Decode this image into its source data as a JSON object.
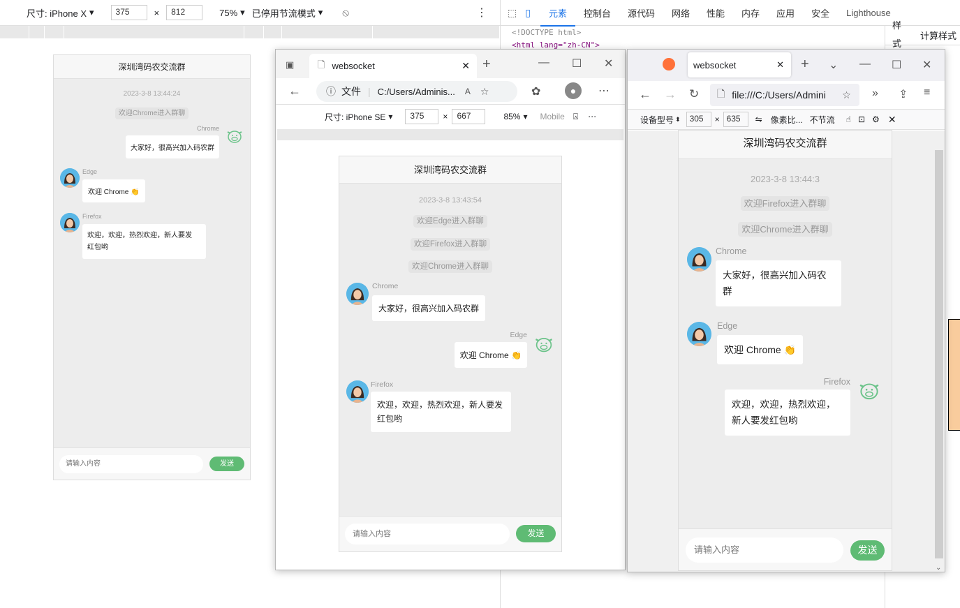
{
  "devtools_bar": {
    "device": "尺寸: iPhone X",
    "width": "375",
    "height": "812",
    "zoom": "75%",
    "throttle": "已停用节流模式"
  },
  "devtools_tabs": [
    "元素",
    "控制台",
    "源代码",
    "网络",
    "性能",
    "内存",
    "应用",
    "安全",
    "Lighthouse"
  ],
  "devtools_side_tabs": [
    "样式",
    "计算样式"
  ],
  "devtools_code": [
    "<!DOCTYPE html>",
    "<html lang=\"zh-CN\">"
  ],
  "chat_left": {
    "title": "深圳湾码农交流群",
    "time": "2023-3-8 13:44:24",
    "system": [
      "欢迎Chrome进入群聊"
    ],
    "msgs": [
      {
        "name": "Chrome",
        "text": "大家好，很高兴加入码农群"
      },
      {
        "name": "Edge",
        "text": "欢迎 Chrome 👏"
      },
      {
        "name": "Firefox",
        "text1": "欢迎，欢迎，热烈欢迎，新人要发",
        "text2": "红包哟"
      }
    ],
    "placeholder": "请输入内容",
    "send": "发送"
  },
  "edge": {
    "tab_title": "websocket",
    "file_label": "文件",
    "url": "C:/Users/Adminis...",
    "device": "尺寸: iPhone SE",
    "width": "375",
    "height": "667",
    "zoom": "85%",
    "mode": "Mobile",
    "chat": {
      "title": "深圳湾码农交流群",
      "time": "2023-3-8 13:43:54",
      "system": [
        "欢迎Edge进入群聊",
        "欢迎Firefox进入群聊",
        "欢迎Chrome进入群聊"
      ],
      "msgs": [
        {
          "name": "Chrome",
          "text": "大家好，很高兴加入码农群"
        },
        {
          "name": "Edge",
          "text": "欢迎 Chrome 👏"
        },
        {
          "name": "Firefox",
          "text1": "欢迎，欢迎，热烈欢迎，新人要发",
          "text2": "红包哟"
        }
      ],
      "placeholder": "请输入内容",
      "send": "发送"
    }
  },
  "firefox": {
    "tab_title": "websocket",
    "url": "file:///C:/Users/Admini",
    "device": "设备型号",
    "width": "305",
    "height": "635",
    "dpr": "像素比...",
    "throttle": "不节流",
    "chat": {
      "title": "深圳湾码农交流群",
      "time": "2023-3-8 13:44:3",
      "system": [
        "欢迎Firefox进入群聊",
        "欢迎Chrome进入群聊"
      ],
      "msgs": [
        {
          "name": "Chrome",
          "text1": "大家好，很高兴加入码农",
          "text2": "群"
        },
        {
          "name": "Edge",
          "text": "欢迎 Chrome 👏"
        },
        {
          "name": "Firefox",
          "text1": "欢迎，欢迎，热烈欢迎，",
          "text2": "新人要发红包哟"
        }
      ],
      "placeholder": "请输入内容",
      "send": "发送"
    }
  }
}
